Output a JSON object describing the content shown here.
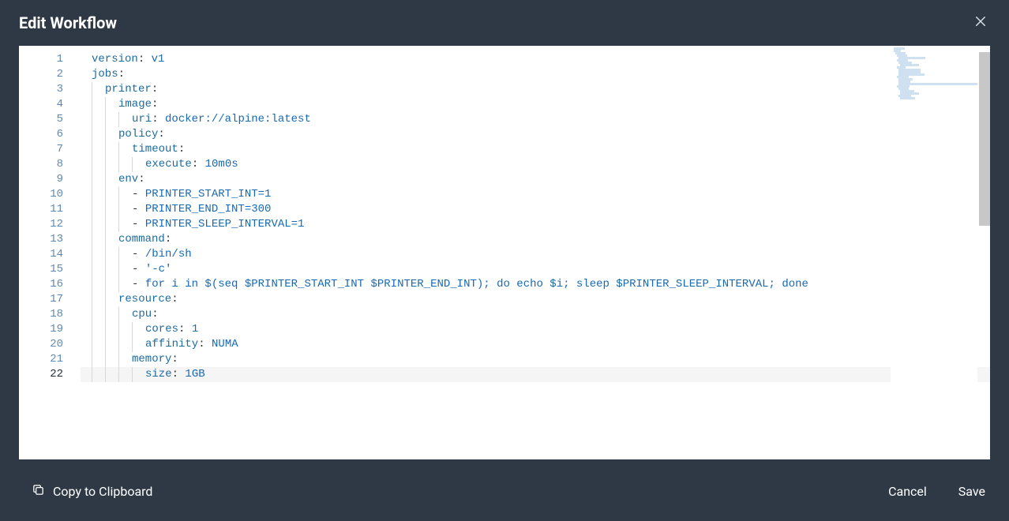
{
  "dialog": {
    "title": "Edit Workflow",
    "close_label": "Close"
  },
  "editor": {
    "current_line": 22,
    "lines": [
      {
        "n": 1,
        "indent": 0,
        "segs": [
          {
            "c": "tk-key",
            "t": "version"
          },
          {
            "c": "tk-punc",
            "t": ":"
          },
          {
            "c": "tk-plain",
            "t": " "
          },
          {
            "c": "tk-str",
            "t": "v1"
          }
        ]
      },
      {
        "n": 2,
        "indent": 0,
        "segs": [
          {
            "c": "tk-key",
            "t": "jobs"
          },
          {
            "c": "tk-punc",
            "t": ":"
          }
        ]
      },
      {
        "n": 3,
        "indent": 1,
        "segs": [
          {
            "c": "tk-key",
            "t": "printer"
          },
          {
            "c": "tk-punc",
            "t": ":"
          }
        ]
      },
      {
        "n": 4,
        "indent": 2,
        "segs": [
          {
            "c": "tk-key",
            "t": "image"
          },
          {
            "c": "tk-punc",
            "t": ":"
          }
        ]
      },
      {
        "n": 5,
        "indent": 3,
        "segs": [
          {
            "c": "tk-key",
            "t": "uri"
          },
          {
            "c": "tk-punc",
            "t": ":"
          },
          {
            "c": "tk-plain",
            "t": " "
          },
          {
            "c": "tk-str",
            "t": "docker://alpine:latest"
          }
        ]
      },
      {
        "n": 6,
        "indent": 2,
        "segs": [
          {
            "c": "tk-key",
            "t": "policy"
          },
          {
            "c": "tk-punc",
            "t": ":"
          }
        ]
      },
      {
        "n": 7,
        "indent": 3,
        "segs": [
          {
            "c": "tk-key",
            "t": "timeout"
          },
          {
            "c": "tk-punc",
            "t": ":"
          }
        ]
      },
      {
        "n": 8,
        "indent": 4,
        "segs": [
          {
            "c": "tk-key",
            "t": "execute"
          },
          {
            "c": "tk-punc",
            "t": ":"
          },
          {
            "c": "tk-plain",
            "t": " "
          },
          {
            "c": "tk-str",
            "t": "10m0s"
          }
        ]
      },
      {
        "n": 9,
        "indent": 2,
        "segs": [
          {
            "c": "tk-key",
            "t": "env"
          },
          {
            "c": "tk-punc",
            "t": ":"
          }
        ]
      },
      {
        "n": 10,
        "indent": 3,
        "segs": [
          {
            "c": "tk-punc",
            "t": "- "
          },
          {
            "c": "tk-str",
            "t": "PRINTER_START_INT=1"
          }
        ]
      },
      {
        "n": 11,
        "indent": 3,
        "segs": [
          {
            "c": "tk-punc",
            "t": "- "
          },
          {
            "c": "tk-str",
            "t": "PRINTER_END_INT=300"
          }
        ]
      },
      {
        "n": 12,
        "indent": 3,
        "segs": [
          {
            "c": "tk-punc",
            "t": "- "
          },
          {
            "c": "tk-str",
            "t": "PRINTER_SLEEP_INTERVAL=1"
          }
        ]
      },
      {
        "n": 13,
        "indent": 2,
        "segs": [
          {
            "c": "tk-key",
            "t": "command"
          },
          {
            "c": "tk-punc",
            "t": ":"
          }
        ]
      },
      {
        "n": 14,
        "indent": 3,
        "segs": [
          {
            "c": "tk-punc",
            "t": "- "
          },
          {
            "c": "tk-str",
            "t": "/bin/sh"
          }
        ]
      },
      {
        "n": 15,
        "indent": 3,
        "segs": [
          {
            "c": "tk-punc",
            "t": "- "
          },
          {
            "c": "tk-str",
            "t": "'-c'"
          }
        ]
      },
      {
        "n": 16,
        "indent": 3,
        "segs": [
          {
            "c": "tk-punc",
            "t": "- "
          },
          {
            "c": "tk-str",
            "t": "for i in $(seq $PRINTER_START_INT $PRINTER_END_INT); do echo $i; sleep $PRINTER_SLEEP_INTERVAL; done"
          }
        ]
      },
      {
        "n": 17,
        "indent": 2,
        "segs": [
          {
            "c": "tk-key",
            "t": "resource"
          },
          {
            "c": "tk-punc",
            "t": ":"
          }
        ]
      },
      {
        "n": 18,
        "indent": 3,
        "segs": [
          {
            "c": "tk-key",
            "t": "cpu"
          },
          {
            "c": "tk-punc",
            "t": ":"
          }
        ]
      },
      {
        "n": 19,
        "indent": 4,
        "segs": [
          {
            "c": "tk-key",
            "t": "cores"
          },
          {
            "c": "tk-punc",
            "t": ":"
          },
          {
            "c": "tk-plain",
            "t": " "
          },
          {
            "c": "tk-num",
            "t": "1"
          }
        ]
      },
      {
        "n": 20,
        "indent": 4,
        "segs": [
          {
            "c": "tk-key",
            "t": "affinity"
          },
          {
            "c": "tk-punc",
            "t": ":"
          },
          {
            "c": "tk-plain",
            "t": " "
          },
          {
            "c": "tk-str",
            "t": "NUMA"
          }
        ]
      },
      {
        "n": 21,
        "indent": 3,
        "segs": [
          {
            "c": "tk-key",
            "t": "memory"
          },
          {
            "c": "tk-punc",
            "t": ":"
          }
        ]
      },
      {
        "n": 22,
        "indent": 4,
        "segs": [
          {
            "c": "tk-key",
            "t": "size"
          },
          {
            "c": "tk-punc",
            "t": ":"
          },
          {
            "c": "tk-plain",
            "t": " "
          },
          {
            "c": "tk-str",
            "t": "1GB"
          }
        ]
      }
    ]
  },
  "footer": {
    "copy_label": "Copy to Clipboard",
    "cancel_label": "Cancel",
    "save_label": "Save"
  }
}
